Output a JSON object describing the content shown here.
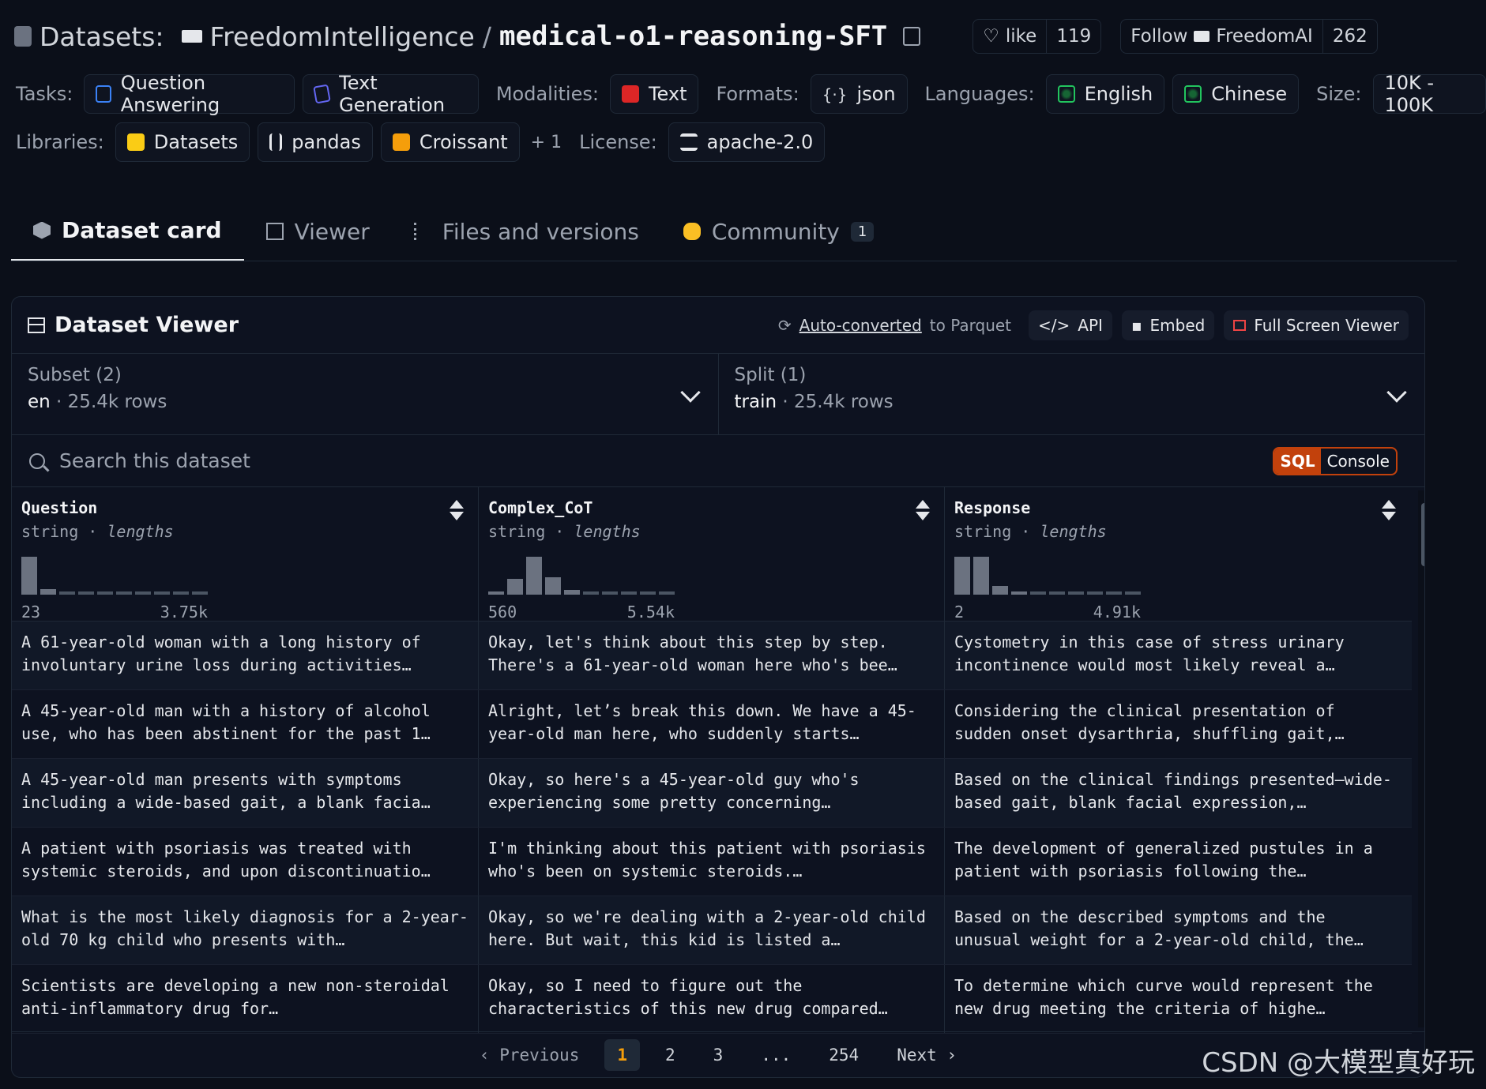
{
  "header": {
    "datasets_label": "Datasets:",
    "org": "FreedomIntelligence",
    "slash": "/",
    "repo": "medical-o1-reasoning-SFT",
    "like_label": "like",
    "like_count": "119",
    "follow_label": "Follow",
    "follow_org": "FreedomAI",
    "follow_count": "262"
  },
  "tags": {
    "tasks_label": "Tasks:",
    "task_qa": "Question Answering",
    "task_tg": "Text Generation",
    "modalities_label": "Modalities:",
    "modality_text": "Text",
    "formats_label": "Formats:",
    "format_json": "json",
    "languages_label": "Languages:",
    "lang_en": "English",
    "lang_zh": "Chinese",
    "size_label": "Size:",
    "size_val": "10K - 100K",
    "libraries_label": "Libraries:",
    "lib_datasets": "Datasets",
    "lib_pandas": "pandas",
    "lib_croissant": "Croissant",
    "lib_more": "+ 1",
    "license_label": "License:",
    "license_val": "apache-2.0"
  },
  "tabs": {
    "card": "Dataset card",
    "viewer": "Viewer",
    "files": "Files and versions",
    "community": "Community",
    "community_badge": "1"
  },
  "viewer": {
    "title": "Dataset Viewer",
    "auto_converted": "Auto-converted",
    "to_parquet": "to Parquet",
    "api": "API",
    "embed": "Embed",
    "full_screen": "Full Screen Viewer",
    "subset_label": "Subset (2)",
    "subset_val": "en",
    "subset_rows": "25.4k rows",
    "split_label": "Split (1)",
    "split_val": "train",
    "split_rows": "25.4k rows",
    "search_placeholder": "Search this dataset",
    "sql": "SQL",
    "console": "Console"
  },
  "columns": [
    {
      "name": "Question",
      "type": "string",
      "sub": "lengths",
      "min": "23",
      "max": "3.75k",
      "hist": [
        1.0,
        0.15,
        0.04,
        0.04,
        0.04,
        0.04,
        0.04,
        0.04,
        0.04,
        0.04
      ]
    },
    {
      "name": "Complex_CoT",
      "type": "string",
      "sub": "lengths",
      "min": "560",
      "max": "5.54k",
      "hist": [
        0.08,
        0.42,
        1.0,
        0.45,
        0.12,
        0.04,
        0.04,
        0.04,
        0.04,
        0.04
      ]
    },
    {
      "name": "Response",
      "type": "string",
      "sub": "lengths",
      "min": "2",
      "max": "4.91k",
      "hist": [
        1.0,
        1.0,
        0.22,
        0.08,
        0.04,
        0.04,
        0.04,
        0.04,
        0.04,
        0.04
      ]
    }
  ],
  "rows": [
    [
      "A 61-year-old woman with a long history of involuntary urine loss during activities…",
      "Okay, let's think about this step by step. There's a 61-year-old woman here who's bee…",
      "Cystometry in this case of stress urinary incontinence would most likely reveal a…"
    ],
    [
      "A 45-year-old man with a history of alcohol use, who has been abstinent for the past 1…",
      "Alright, let’s break this down. We have a 45-year-old man here, who suddenly starts…",
      "Considering the clinical presentation of sudden onset dysarthria, shuffling gait,…"
    ],
    [
      "A 45-year-old man presents with symptoms including a wide-based gait, a blank facia…",
      "Okay, so here's a 45-year-old guy who's experiencing some pretty concerning…",
      "Based on the clinical findings presented—wide-based gait, blank facial expression,…"
    ],
    [
      "A patient with psoriasis was treated with systemic steroids, and upon discontinuatio…",
      "I'm thinking about this patient with psoriasis who's been on systemic steroids.…",
      "The development of generalized pustules in a patient with psoriasis following the…"
    ],
    [
      "What is the most likely diagnosis for a 2-year-old 70 kg child who presents with…",
      "Okay, so we're dealing with a 2-year-old child here. But wait, this kid is listed a…",
      "Based on the described symptoms and the unusual weight for a 2-year-old child, the…"
    ],
    [
      "Scientists are developing a new non-steroidal anti-inflammatory drug for…",
      "Okay, so I need to figure out the characteristics of this new drug compared…",
      "To determine which curve would represent the new drug meeting the criteria of highe…"
    ]
  ],
  "pager": {
    "previous": "Previous",
    "p1": "1",
    "p2": "2",
    "p3": "3",
    "ellipsis": "...",
    "last": "254",
    "next": "Next"
  },
  "watermark": "CSDN @大模型真好玩",
  "colors": {
    "background": "#0b0f19",
    "accent_orange": "#f59e0b",
    "sql_orange": "#c2410c"
  }
}
